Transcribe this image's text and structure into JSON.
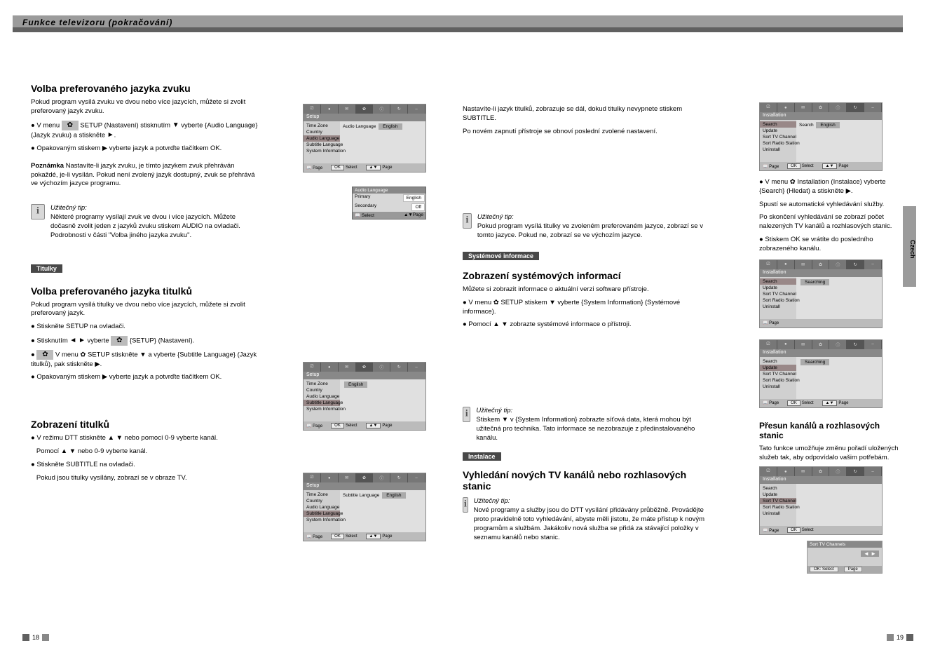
{
  "header": {
    "title": "Funkce televizoru (pokračování)"
  },
  "pageNumbers": {
    "left": "18",
    "right": "19"
  },
  "sideTab": "Czech",
  "symbols": {
    "gear": "✿",
    "triR": "►",
    "triL": "◄",
    "triU": "▲",
    "triD": "▼",
    "book": "📖"
  },
  "col1": {
    "s1": {
      "title": "Volba preferovaného jazyka zvuku",
      "intro": "Pokud program vysílá zvuku ve dvou nebo více jazycích, můžete si zvolit preferovaný jazyk zvuku.",
      "step1a": "V menu ",
      "step1b": " SETUP (Nastavení) stisknutím ",
      "step1c": " vyberte {Audio Language} (Jazyk zvuku) a stiskněte",
      "step2": "Opakovaným stiskem ▶ vyberte jazyk a potvrďte tlačítkem OK.",
      "noteLead": "Poznámka",
      "note": "Nastavíte-li jazyk zvuku, je tímto jazykem zvuk přehráván pokaždé, je-li vysílán. Pokud není zvolený jazyk dostupný, zvuk se přehrává ve výchozím jazyce programu."
    },
    "info1": {
      "title": "Užitečný tip:",
      "body": "Některé programy vysílají zvuk ve dvou i více jazycích. Můžete dočasně zvolit jeden z jazyků zvuku stiskem AUDIO na ovladači. Podrobnosti v části \"Volba jiného jazyka zvuku\"."
    },
    "s2": {
      "blackbar": "Titulky"
    },
    "s3": {
      "title": "Volba preferovaného jazyka titulků",
      "intro": "Pokud program vysílá titulky ve dvou nebo více jazycích, můžete si zvolit preferovaný jazyk.",
      "step1": "Stiskněte SETUP na ovladači.",
      "step2a": "Stisknutím ",
      "step2b": " vyberte ",
      "step2c": " {SETUP} (Nastavení).",
      "step3": "V menu ✿ SETUP stiskněte ▼ a vyberte {Subtitle Language} (Jazyk titulků), pak stiskněte ▶.",
      "step4": "Opakovaným stiskem ▶ vyberte jazyk a potvrďte tlačítkem OK."
    },
    "s4": {
      "title": "Zobrazení titulků",
      "step1a": "V režimu DTT stiskněte ▲ ▼ nebo pomocí 0-9 vyberte kanál.",
      "step1b": "Pomocí ▲ ▼ nebo 0-9 vyberte kanál.",
      "step2": "Stiskněte SUBTITLE na ovladači.",
      "step3": "Pokud jsou titulky vysílány, zobrazí se v obraze TV."
    }
  },
  "col2": {
    "panel1": {
      "header": "Setup",
      "items": [
        "Time Zone",
        "Country",
        "Audio Language",
        "Subtitle Language",
        "System Information"
      ],
      "selected": 2,
      "right": {
        "label": "Audio Language",
        "value": "English"
      },
      "footer": [
        "Page",
        "Select",
        "Page"
      ]
    },
    "submenu": {
      "header": "Audio Language",
      "rows": [
        {
          "label": "Primary",
          "value": "English"
        },
        {
          "label": "Secondary",
          "value": "Off"
        }
      ],
      "footer": [
        "Select",
        "Page"
      ]
    },
    "panel2": {
      "header": "Setup",
      "items": [
        "Time Zone",
        "Country",
        "Audio Language",
        "Subtitle Language",
        "System Information"
      ],
      "selected": 3,
      "right": {
        "value": "English"
      },
      "footer": [
        "Page",
        "Select",
        "Page"
      ]
    },
    "panel3": {
      "header": "Setup",
      "items": [
        "Time Zone",
        "Country",
        "Audio Language",
        "Subtitle Language",
        "System Information"
      ],
      "selected": 3,
      "right": {
        "label": "Subtitle Language",
        "value": "English"
      },
      "footer": [
        "Page",
        "Select",
        "Page"
      ]
    }
  },
  "col3": {
    "p1": "Nastavíte-li jazyk titulků, zobrazuje se dál, dokud titulky nevypnete stiskem SUBTITLE.",
    "p2": "Po novém zapnutí přístroje se obnoví poslední zvolené nastavení.",
    "info1": {
      "title": "Užitečný tip:",
      "body": "Pokud program vysílá titulky ve zvoleném preferovaném jazyce, zobrazí se v tomto jazyce. Pokud ne, zobrazí se ve výchozím jazyce."
    },
    "black1": "Systémové informace",
    "s1": {
      "title": "Zobrazení systémových informací",
      "p": "Můžete si zobrazit informace o aktuální verzi software přístroje.",
      "step1": "V menu ✿ SETUP stiskem ▼ vyberte {System Information} (Systémové informace).",
      "step2": "Pomocí ▲ ▼ zobrazte systémové informace o přístroji."
    },
    "info2": {
      "title": "Užitečný tip:",
      "body": "Stiskem ▼ v {System Information} zobrazte síťová data, která mohou být užitečná pro technika. Tato informace se nezobrazuje z předinstalovaného kanálu."
    },
    "black2": "Instalace",
    "s2": {
      "title": "Vyhledání nových TV kanálů nebo rozhlasových stanic"
    },
    "info3": {
      "title": "Užitečný tip:",
      "body": "Nové programy a služby jsou do DTT vysílání přidávány průběžně. Provádějte proto pravidelně toto vyhledávání, abyste měli jistotu, že máte přístup k novým programům a službám. Jakákoliv nová služba se přidá za stávající položky v seznamu kanálů nebo stanic."
    }
  },
  "col4": {
    "panel1": {
      "header": "Installation",
      "items": [
        "Search",
        "Update",
        "Sort TV Channel",
        "Sort Radio Station",
        "Uninstall"
      ],
      "selected": 0,
      "right": {
        "label": "Search",
        "value": "English"
      },
      "footer": [
        "Page",
        "Select",
        "Page"
      ]
    },
    "step1": "V menu ✿ Installation (Instalace) vyberte {Search} (Hledat) a stiskněte ▶.",
    "step1b": "Spustí se automatické vyhledávání služby.",
    "step1c": "Po skončení vyhledávání se zobrazí počet nalezených TV kanálů a rozhlasových stanic.",
    "step2": "Stiskem OK se vrátíte do posledního zobrazeného kanálu.",
    "panel2": {
      "header": "Installation",
      "items": [
        "Search",
        "Update",
        "Sort TV Channel",
        "Sort Radio Station",
        "Uninstall"
      ],
      "selected": 0,
      "right": {
        "value": "Searching"
      },
      "footer": [
        "Page"
      ]
    },
    "panel3": {
      "header": "Installation",
      "items": [
        "Search",
        "Update",
        "Sort TV Channel",
        "Sort Radio Station",
        "Uninstall"
      ],
      "selected": 1,
      "right": {
        "value": "Searching"
      },
      "footer": [
        "Page",
        "Select",
        "Page"
      ]
    },
    "s2": {
      "title": "Přesun kanálů a rozhlasových stanic",
      "p": "Tato funkce umožňuje změnu pořadí uložených služeb tak, aby odpovídalo vašim potřebám."
    },
    "panel4": {
      "header": "Installation",
      "items": [
        "Search",
        "Update",
        "Sort TV Channel",
        "Sort Radio Station",
        "Uninstall"
      ],
      "selected": 2,
      "footer": [
        "Page",
        "Select"
      ]
    },
    "strip": {
      "header": "Sort TV Channels",
      "footer": [
        "OK: Select",
        "Page"
      ],
      "arrows": "◄ ►"
    }
  },
  "menuTabs": [
    "⎚",
    "●",
    "✉",
    "✿",
    "ⓘ",
    "↻",
    "–"
  ]
}
